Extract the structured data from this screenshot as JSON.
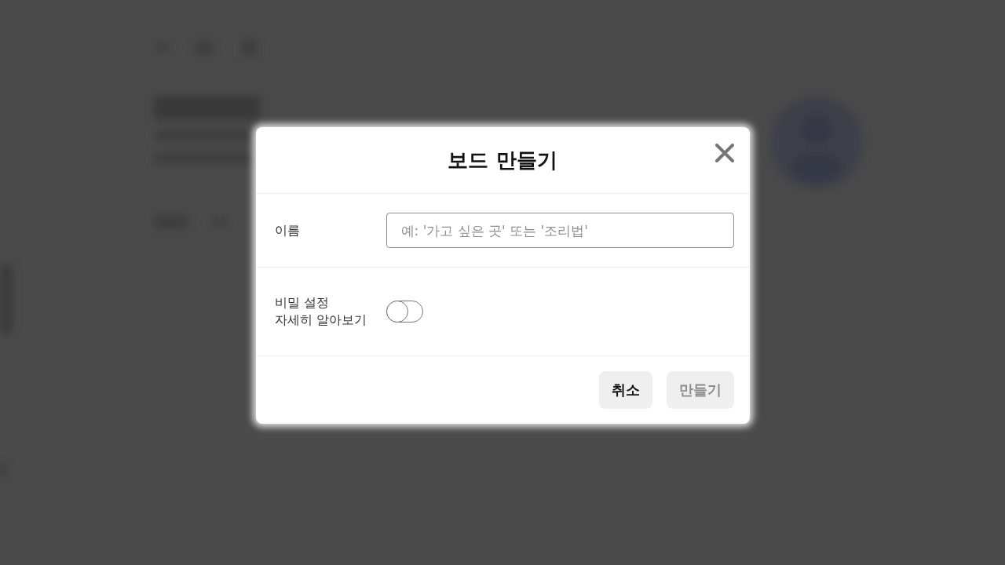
{
  "dialog": {
    "title": "보드 만들기",
    "fields": [
      {
        "kind": "text",
        "label": "이름",
        "placeholder": "예: '가고 싶은 곳' 또는 '조리법'"
      },
      {
        "kind": "toggle",
        "label": "비밀 설정",
        "link": "자세히 알아보기",
        "on": false
      }
    ],
    "buttons": [
      {
        "label": "취소",
        "disabled": false
      },
      {
        "label": "만들기",
        "disabled": true
      }
    ]
  }
}
